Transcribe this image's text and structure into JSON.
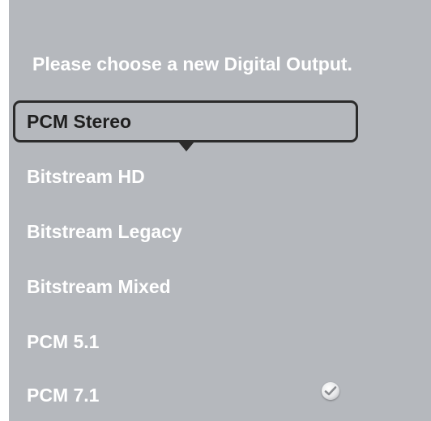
{
  "dialog": {
    "prompt": "Please choose a new Digital Output."
  },
  "options": [
    {
      "label": "PCM Stereo",
      "focused": true,
      "checked": false
    },
    {
      "label": "Bitstream HD",
      "focused": false,
      "checked": false
    },
    {
      "label": "Bitstream Legacy",
      "focused": false,
      "checked": false
    },
    {
      "label": "Bitstream Mixed",
      "focused": false,
      "checked": false
    },
    {
      "label": "PCM 5.1",
      "focused": false,
      "checked": false
    },
    {
      "label": "PCM 7.1",
      "focused": false,
      "checked": true
    }
  ],
  "icons": {
    "focus_indicator": "down-pointer-icon",
    "checked_indicator": "checkmark-icon"
  },
  "colors": {
    "background": "#b5b8bd",
    "text": "#ffffff",
    "focus": "#2b2b2b"
  }
}
